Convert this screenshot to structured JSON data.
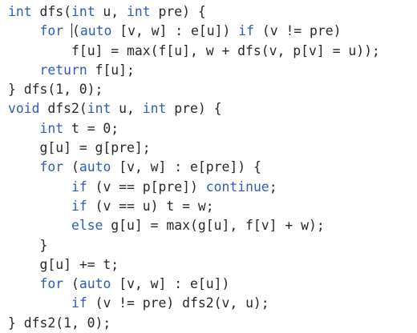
{
  "editor": {
    "lines": [
      {
        "indent": 0,
        "tokens": [
          {
            "t": "int",
            "k": "kw"
          },
          {
            "t": " dfs("
          },
          {
            "t": "int",
            "k": "kw"
          },
          {
            "t": " u, "
          },
          {
            "t": "int",
            "k": "kw"
          },
          {
            "t": " pre) {"
          }
        ]
      },
      {
        "indent": 4,
        "tokens": [
          {
            "t": "for",
            "k": "kw"
          },
          {
            "t": " ",
            "cursor": true
          },
          {
            "t": "("
          },
          {
            "t": "auto",
            "k": "kw"
          },
          {
            "t": " [v, w] : e[u]) "
          },
          {
            "t": "if",
            "k": "kw"
          },
          {
            "t": " (v != pre)"
          }
        ]
      },
      {
        "indent": 8,
        "tokens": [
          {
            "t": "f[u] = max(f[u], w + dfs(v, p[v] = u));"
          }
        ]
      },
      {
        "indent": 4,
        "tokens": [
          {
            "t": "return",
            "k": "kw"
          },
          {
            "t": " f[u];"
          }
        ]
      },
      {
        "indent": 0,
        "tokens": [
          {
            "t": "} dfs(1, 0);"
          }
        ]
      },
      {
        "indent": 0,
        "tokens": [
          {
            "t": "void",
            "k": "kw"
          },
          {
            "t": " dfs2("
          },
          {
            "t": "int",
            "k": "kw"
          },
          {
            "t": " u, "
          },
          {
            "t": "int",
            "k": "kw"
          },
          {
            "t": " pre) {"
          }
        ]
      },
      {
        "indent": 4,
        "tokens": [
          {
            "t": "int",
            "k": "kw"
          },
          {
            "t": " t = 0;"
          }
        ]
      },
      {
        "indent": 4,
        "tokens": [
          {
            "t": "g[u] = g[pre];"
          }
        ]
      },
      {
        "indent": 4,
        "tokens": [
          {
            "t": "for",
            "k": "kw"
          },
          {
            "t": " ("
          },
          {
            "t": "auto",
            "k": "kw"
          },
          {
            "t": " [v, w] : e[pre]) {"
          }
        ]
      },
      {
        "indent": 8,
        "tokens": [
          {
            "t": "if",
            "k": "kw"
          },
          {
            "t": " (v == p[pre]) "
          },
          {
            "t": "continue",
            "k": "kw"
          },
          {
            "t": ";"
          }
        ]
      },
      {
        "indent": 8,
        "tokens": [
          {
            "t": "if",
            "k": "kw"
          },
          {
            "t": " (v == u) t = w;"
          }
        ]
      },
      {
        "indent": 8,
        "tokens": [
          {
            "t": "else",
            "k": "kw"
          },
          {
            "t": " g[u] = max(g[u], f[v] + w);"
          }
        ]
      },
      {
        "indent": 4,
        "tokens": [
          {
            "t": "}"
          }
        ]
      },
      {
        "indent": 4,
        "tokens": [
          {
            "t": "g[u] += t;"
          }
        ]
      },
      {
        "indent": 4,
        "tokens": [
          {
            "t": "for",
            "k": "kw"
          },
          {
            "t": " ("
          },
          {
            "t": "auto",
            "k": "kw"
          },
          {
            "t": " [v, w] : e[u])"
          }
        ]
      },
      {
        "indent": 8,
        "tokens": [
          {
            "t": "if",
            "k": "kw"
          },
          {
            "t": " (v != pre) dfs2(v, u);"
          }
        ]
      },
      {
        "indent": 0,
        "tokens": [
          {
            "t": "} dfs2(1, 0);"
          }
        ]
      }
    ]
  },
  "colors": {
    "keyword": "#2e5cb8",
    "text": "#24292e",
    "background": "#ffffff"
  }
}
